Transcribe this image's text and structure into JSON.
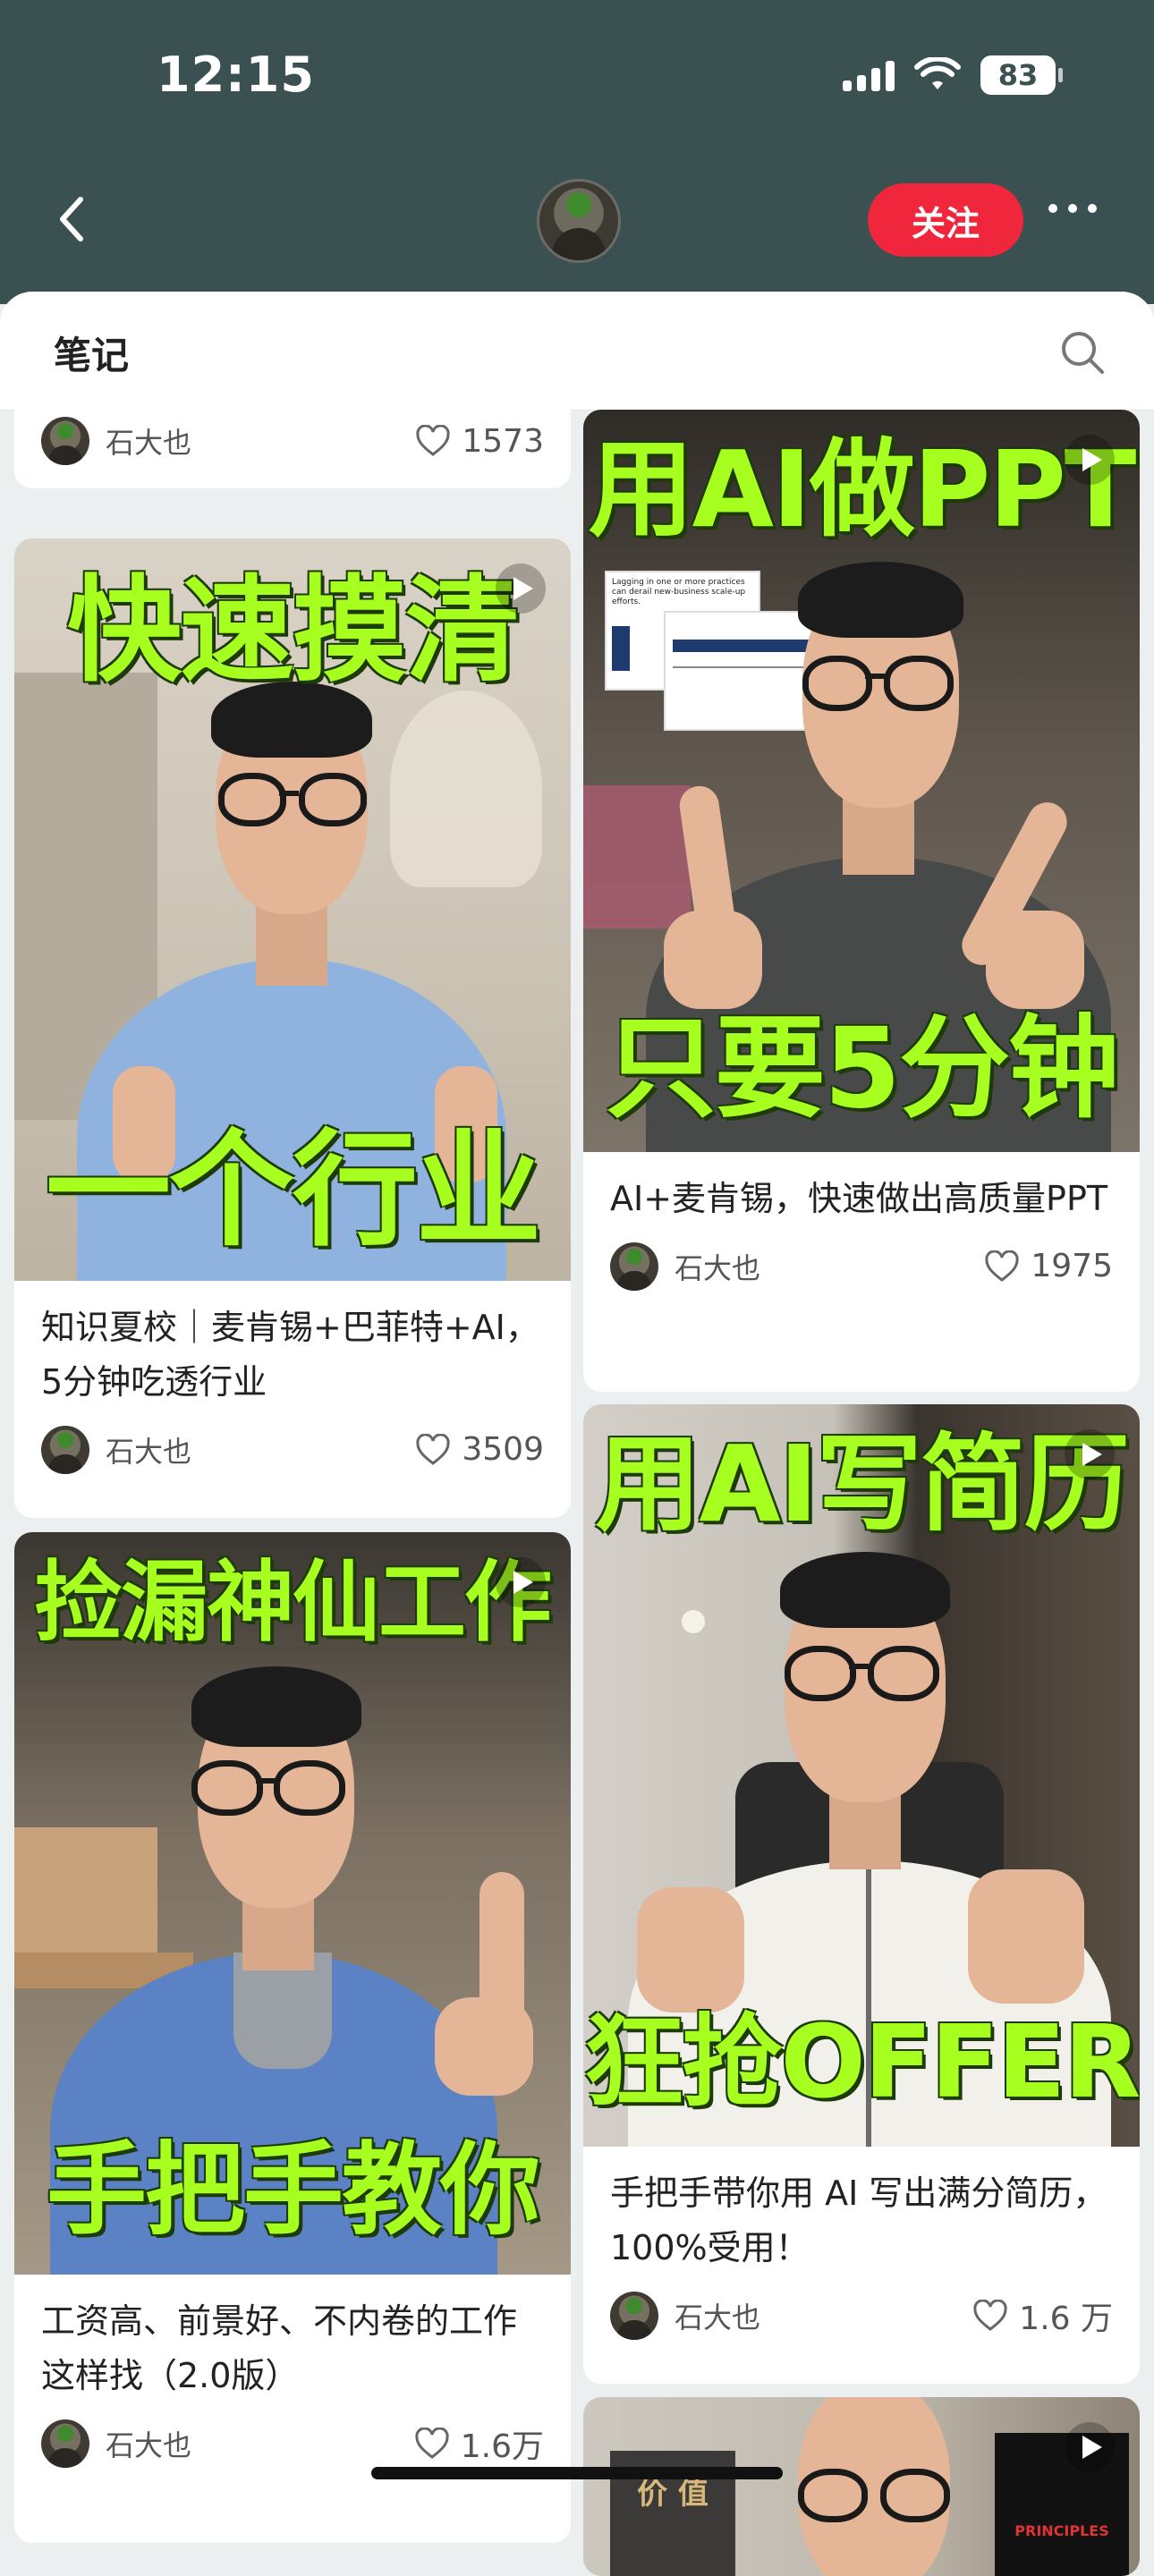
{
  "status_bar": {
    "time": "12:15",
    "battery": "83"
  },
  "header": {
    "follow_label": "关注"
  },
  "section": {
    "title": "笔记"
  },
  "left_column": [
    {
      "title": "",
      "author": "石大也",
      "likes": "1573",
      "partial": true
    },
    {
      "overlay_top": "快速摸清",
      "overlay_bottom": "一个行业",
      "title": "知识夏校｜麦肯锡+巴菲特+AI，5分钟吃透行业",
      "author": "石大也",
      "likes": "3509"
    },
    {
      "overlay_top": "捡漏神仙工作",
      "overlay_bottom": "手把手教你",
      "title": "工资高、前景好、不内卷的工作这样找（2.0版）",
      "author": "石大也",
      "likes": "1.6万"
    }
  ],
  "right_column": [
    {
      "overlay_top": "用AI做PPT",
      "overlay_bottom": "只要5分钟",
      "title": "AI+麦肯锡，快速做出高质量PPT",
      "author": "石大也",
      "likes": "1975"
    },
    {
      "overlay_top": "用AI写简历",
      "overlay_bottom": "狂抢OFFER",
      "title": "手把手带你用 AI 写出满分简历，100%受用！",
      "author": "石大也",
      "likes": "1.6 万"
    },
    {
      "overlay_top": "",
      "overlay_bottom": "",
      "title": "",
      "author": "",
      "likes": ""
    }
  ],
  "thumb_texts": {
    "slide_heading": "Lagging in one or more practices can derail new-business scale-up efforts.",
    "book_left": "价 值",
    "book_right": "PRINCIPLES"
  }
}
